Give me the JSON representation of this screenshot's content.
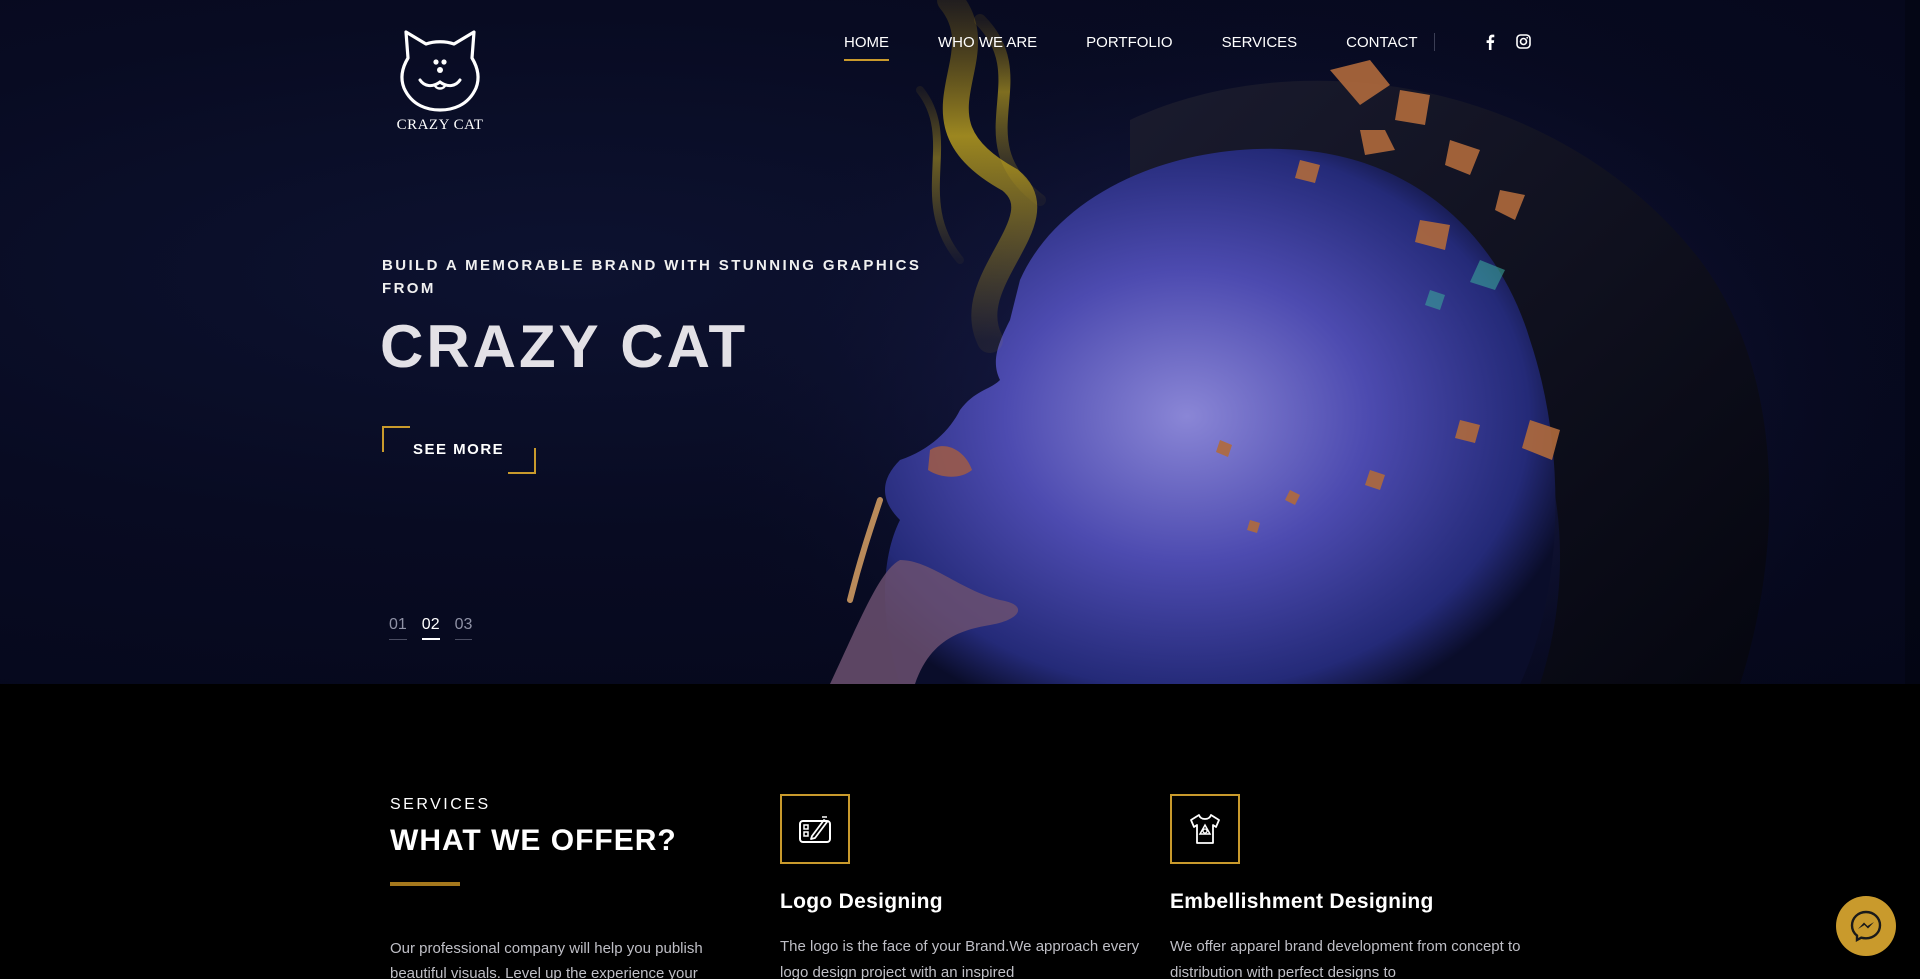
{
  "brand": {
    "name": "CRAZY CAT"
  },
  "nav": {
    "items": [
      {
        "label": "HOME",
        "active": true
      },
      {
        "label": "WHO WE ARE",
        "active": false
      },
      {
        "label": "PORTFOLIO",
        "active": false
      },
      {
        "label": "SERVICES",
        "active": false
      },
      {
        "label": "CONTACT",
        "active": false
      }
    ],
    "social": [
      {
        "icon": "facebook-icon",
        "glyph": "f"
      },
      {
        "icon": "instagram-icon",
        "glyph": "◎"
      }
    ]
  },
  "hero": {
    "subtitle": "BUILD A MEMORABLE BRAND WITH STUNNING GRAPHICS FROM",
    "title": "CRAZY CAT",
    "cta": "SEE MORE",
    "slides": [
      {
        "label": "01",
        "active": false
      },
      {
        "label": "02",
        "active": true
      },
      {
        "label": "03",
        "active": false
      }
    ]
  },
  "services": {
    "label": "SERVICES",
    "title": "WHAT WE OFFER?",
    "intro": "Our professional company will help you publish beautiful visuals. Level up the experience your",
    "cards": [
      {
        "icon": "drawing-tablet-icon",
        "title": "Logo Designing",
        "text": "The logo is the face of your Brand.We approach every logo design project with an inspired"
      },
      {
        "icon": "tshirt-icon",
        "title": "Embellishment Designing",
        "text": "We offer apparel brand development from concept to distribution with perfect designs to"
      }
    ]
  },
  "colors": {
    "accent": "#c99a2c",
    "hero_bg": "#080b22",
    "section_bg": "#000000"
  },
  "widgets": {
    "messenger_icon": "messenger-icon"
  }
}
